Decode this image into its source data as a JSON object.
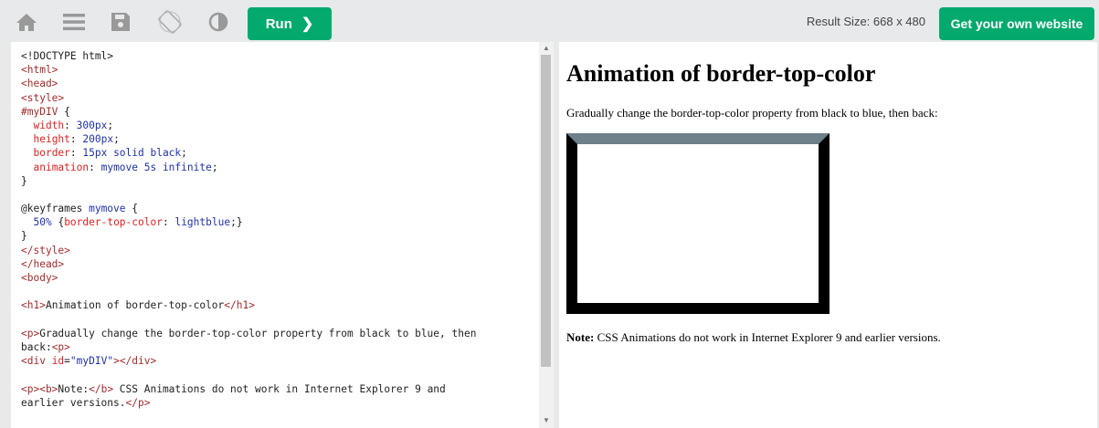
{
  "toolbar": {
    "icons": [
      "home-icon",
      "menu-icon",
      "save-icon",
      "rotate-icon",
      "theme-icon"
    ],
    "run_label": "Run",
    "run_chevron": "❯",
    "result_size": "Result Size: 668 x 480",
    "get_website_label": "Get your own website"
  },
  "editor": {
    "lines": [
      [
        [
          "dark",
          "<!DOCTYPE html>"
        ]
      ],
      [
        [
          "tag",
          "<html>"
        ]
      ],
      [
        [
          "tag",
          "<head>"
        ]
      ],
      [
        [
          "tag",
          "<style>"
        ]
      ],
      [
        [
          "sel",
          "#myDIV"
        ],
        [
          "dark",
          " {"
        ]
      ],
      [
        [
          "dark",
          "  "
        ],
        [
          "prop",
          "width"
        ],
        [
          "dark",
          ": "
        ],
        [
          "val",
          "300px"
        ],
        [
          "dark",
          ";"
        ]
      ],
      [
        [
          "dark",
          "  "
        ],
        [
          "prop",
          "height"
        ],
        [
          "dark",
          ": "
        ],
        [
          "val",
          "200px"
        ],
        [
          "dark",
          ";"
        ]
      ],
      [
        [
          "dark",
          "  "
        ],
        [
          "prop",
          "border"
        ],
        [
          "dark",
          ": "
        ],
        [
          "val",
          "15px solid black"
        ],
        [
          "dark",
          ";"
        ]
      ],
      [
        [
          "dark",
          "  "
        ],
        [
          "prop",
          "animation"
        ],
        [
          "dark",
          ": "
        ],
        [
          "val",
          "mymove 5s infinite"
        ],
        [
          "dark",
          ";"
        ]
      ],
      [
        [
          "dark",
          "}"
        ]
      ],
      [
        [
          "dark",
          ""
        ]
      ],
      [
        [
          "dark",
          "@keyframes "
        ],
        [
          "val",
          "mymove"
        ],
        [
          "dark",
          " {"
        ]
      ],
      [
        [
          "dark",
          "  "
        ],
        [
          "val",
          "50%"
        ],
        [
          "dark",
          " {"
        ],
        [
          "prop",
          "border-top-color"
        ],
        [
          "dark",
          ": "
        ],
        [
          "val",
          "lightblue"
        ],
        [
          "dark",
          ";}"
        ]
      ],
      [
        [
          "dark",
          "}"
        ]
      ],
      [
        [
          "tag",
          "</style>"
        ]
      ],
      [
        [
          "tag",
          "</head>"
        ]
      ],
      [
        [
          "tag",
          "<body>"
        ]
      ],
      [
        [
          "dark",
          ""
        ]
      ],
      [
        [
          "tag",
          "<h1>"
        ],
        [
          "dark",
          "Animation of border-top-color"
        ],
        [
          "tag",
          "</h1>"
        ]
      ],
      [
        [
          "dark",
          ""
        ]
      ],
      [
        [
          "tag",
          "<p>"
        ],
        [
          "dark",
          "Gradually change the border-top-color property from black to blue, then"
        ]
      ],
      [
        [
          "dark",
          "back:"
        ],
        [
          "tag",
          "<p>"
        ]
      ],
      [
        [
          "tag",
          "<div "
        ],
        [
          "attr",
          "id"
        ],
        [
          "dark",
          "="
        ],
        [
          "str",
          "\"myDIV\""
        ],
        [
          "tag",
          "></div>"
        ]
      ],
      [
        [
          "dark",
          ""
        ]
      ],
      [
        [
          "tag",
          "<p><b>"
        ],
        [
          "dark",
          "Note:"
        ],
        [
          "tag",
          "</b>"
        ],
        [
          "dark",
          " CSS Animations do not work in Internet Explorer 9 and"
        ]
      ],
      [
        [
          "dark",
          "earlier versions."
        ],
        [
          "tag",
          "</p>"
        ]
      ]
    ]
  },
  "result": {
    "heading": "Animation of border-top-color",
    "paragraph": "Gradually change the border-top-color property from black to blue, then back:",
    "note_label": "Note:",
    "note_text": " CSS Animations do not work in Internet Explorer 9 and earlier versions.",
    "box_border_color": "#000000",
    "box_border_top_color": "#6e8089"
  },
  "colors": {
    "accent": "#04aa6d",
    "toolbar_bg": "#e7e9eb",
    "icon": "#999999"
  }
}
